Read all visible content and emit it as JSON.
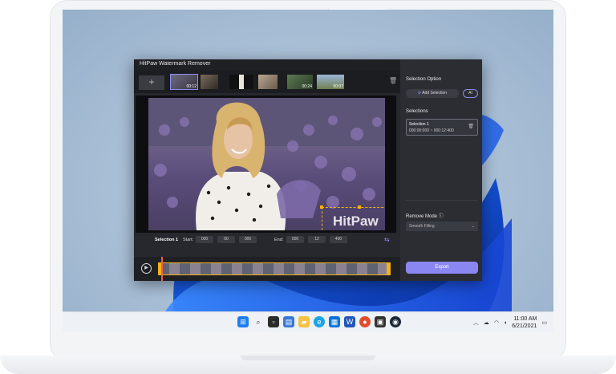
{
  "app": {
    "title": "HitPaw Watermark Remover",
    "win_controls": [
      "☰",
      "—",
      "☐",
      "✕"
    ]
  },
  "thumbnails": [
    {
      "time": "00:12",
      "selected": true
    },
    {
      "time": ""
    },
    {
      "time": ""
    },
    {
      "time": ""
    },
    {
      "time": "00:24"
    },
    {
      "time": "00:07"
    }
  ],
  "watermark_text": "HitPaw",
  "selection_bar": {
    "name": "Selection 1",
    "start_label": "Start:",
    "end_label": "End:",
    "start": [
      "000",
      "00",
      "000"
    ],
    "end": [
      "000",
      "12",
      "400"
    ]
  },
  "panel": {
    "selection_option": "Selection Option",
    "add_selection": "Add Selection",
    "ai": "AI",
    "selections_title": "Selections",
    "selection_name": "Selection 1",
    "selection_range": "000:00:000 ~ 000:12:400",
    "remove_mode_title": "Remove Mode",
    "remove_mode_value": "Smooth Filling",
    "export": "Export"
  },
  "clock": {
    "time": "11:00 AM",
    "date": "6/21/2021"
  }
}
